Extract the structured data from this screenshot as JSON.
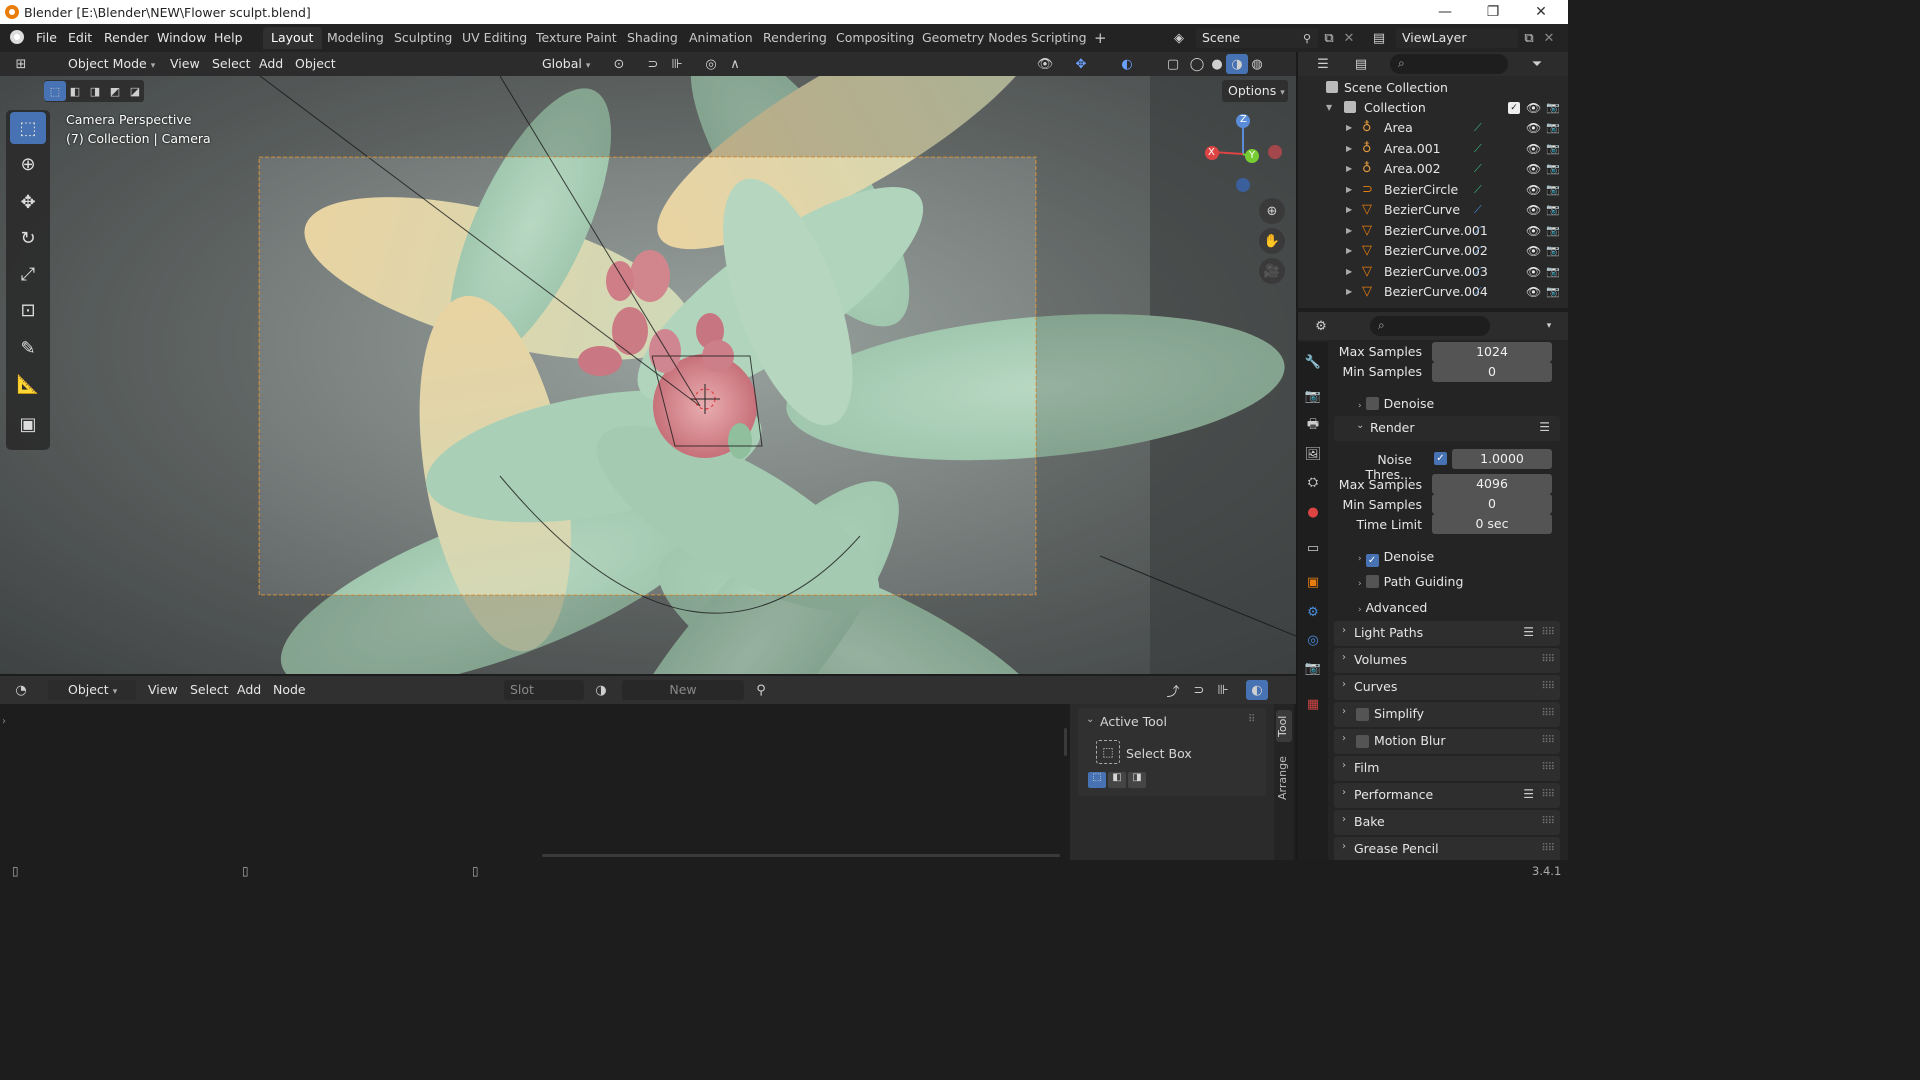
{
  "window": {
    "title": "Blender [E:\\Blender\\NEW\\Flower sculpt.blend]",
    "minimize": "—",
    "maximize": "❐",
    "close": "✕"
  },
  "menu": [
    "File",
    "Edit",
    "Render",
    "Window",
    "Help"
  ],
  "workspaces": [
    "Layout",
    "Modeling",
    "Sculpting",
    "UV Editing",
    "Texture Paint",
    "Shading",
    "Animation",
    "Rendering",
    "Compositing",
    "Geometry Nodes",
    "Scripting"
  ],
  "active_workspace": "Layout",
  "add_workspace": "+",
  "scene": {
    "name": "Scene"
  },
  "view_layer": {
    "name": "ViewLayer"
  },
  "viewport_header": {
    "mode": "Object Mode",
    "menus": [
      "View",
      "Select",
      "Add",
      "Object"
    ],
    "orientation": "Global",
    "options": "Options"
  },
  "viewport": {
    "overlay_line1": "Camera Perspective",
    "overlay_line2": "(7) Collection | Camera",
    "gizmo": {
      "x": "X",
      "y": "Y",
      "z": "Z"
    }
  },
  "outliner": {
    "root": "Scene Collection",
    "collection": "Collection",
    "items": [
      {
        "name": "Area",
        "type": "light"
      },
      {
        "name": "Area.001",
        "type": "light"
      },
      {
        "name": "Area.002",
        "type": "light"
      },
      {
        "name": "BezierCircle",
        "type": "curve"
      },
      {
        "name": "BezierCurve",
        "type": "mesh"
      },
      {
        "name": "BezierCurve.001",
        "type": "mesh"
      },
      {
        "name": "BezierCurve.002",
        "type": "mesh"
      },
      {
        "name": "BezierCurve.003",
        "type": "mesh"
      },
      {
        "name": "BezierCurve.004",
        "type": "mesh"
      }
    ]
  },
  "properties": {
    "viewport_max_samples": {
      "label": "Max Samples",
      "value": "1024"
    },
    "viewport_min_samples": {
      "label": "Min Samples",
      "value": "0"
    },
    "viewport_denoise": "Denoise",
    "render_panel": "Render",
    "noise_threshold": {
      "label": "Noise Thres...",
      "value": "1.0000"
    },
    "render_max_samples": {
      "label": "Max Samples",
      "value": "4096"
    },
    "render_min_samples": {
      "label": "Min Samples",
      "value": "0"
    },
    "time_limit": {
      "label": "Time Limit",
      "value": "0 sec"
    },
    "render_denoise": "Denoise",
    "path_guiding": "Path Guiding",
    "advanced": "Advanced",
    "panels": [
      "Light Paths",
      "Volumes",
      "Curves",
      "Simplify",
      "Motion Blur",
      "Film",
      "Performance",
      "Bake",
      "Grease Pencil"
    ]
  },
  "node_editor": {
    "type": "Object",
    "menus": [
      "View",
      "Select",
      "Add",
      "Node"
    ],
    "slot": "Slot",
    "new_button": "New",
    "tool_panel": {
      "title": "Active Tool",
      "tool_name": "Select Box"
    },
    "side_tabs": [
      "Tool",
      "Arrange"
    ]
  },
  "status": {
    "version": "3.4.1"
  },
  "colors": {
    "accent": "#4772b3",
    "selected_camera": "#e89b3c",
    "bg": "#1d1d1d"
  }
}
